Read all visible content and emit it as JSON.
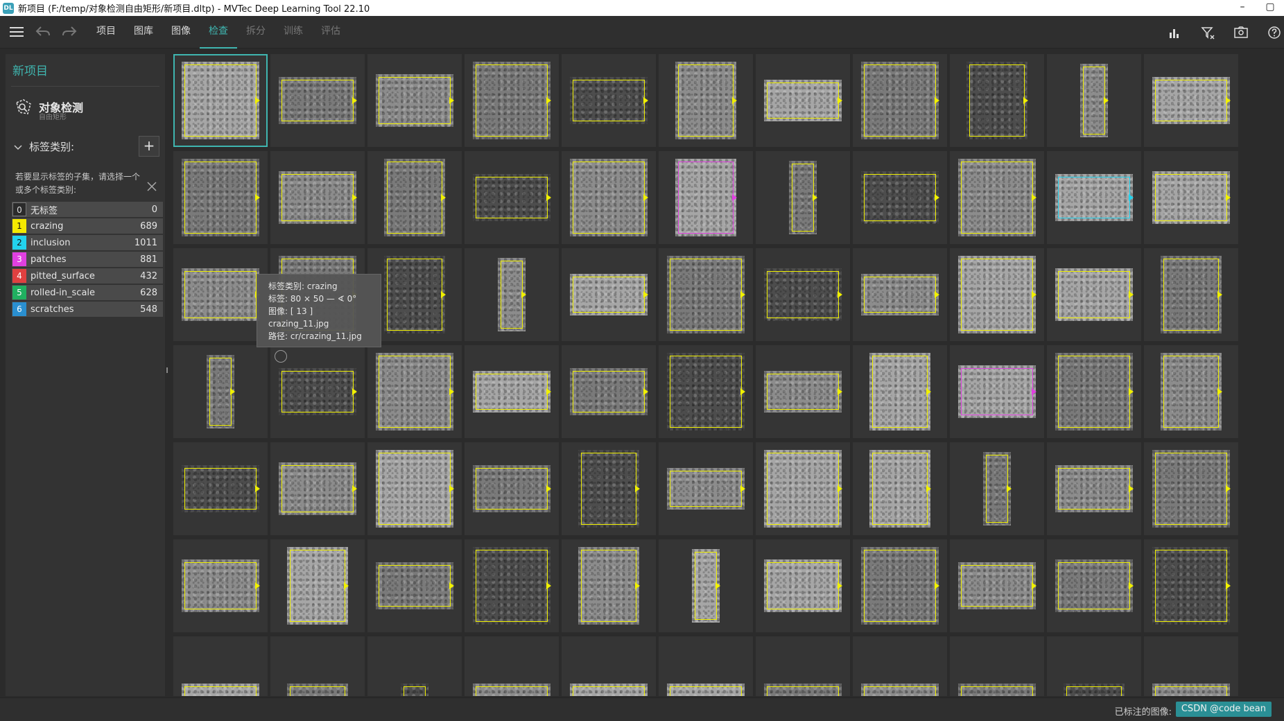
{
  "window": {
    "title": "新项目 (F:/temp/对象检测自由矩形/新项目.dltp) - MVTec Deep Learning Tool 22.10",
    "minimize": "–",
    "maximize": "▢"
  },
  "toolbar": {
    "menu": [
      "项目",
      "图库",
      "图像",
      "检查",
      "拆分",
      "训练",
      "评估"
    ],
    "active_menu": "检查",
    "disabled_menu": [
      "拆分",
      "训练",
      "评估"
    ]
  },
  "sidebar": {
    "project_title": "新项目",
    "task_name": "对象检测",
    "task_sub": "自由矩形",
    "section_title": "标签类别:",
    "add_label": "+",
    "hint": "若要显示标签的子集，请选择一个或多个标签类别:",
    "classes": [
      {
        "idx": "0",
        "name": "无标签",
        "count": "0",
        "color": "#2b2b2b"
      },
      {
        "idx": "1",
        "name": "crazing",
        "count": "689",
        "color": "#f5ea00"
      },
      {
        "idx": "2",
        "name": "inclusion",
        "count": "1011",
        "color": "#22d3ee"
      },
      {
        "idx": "3",
        "name": "patches",
        "count": "881",
        "color": "#e040e0"
      },
      {
        "idx": "4",
        "name": "pitted_surface",
        "count": "432",
        "color": "#e04040"
      },
      {
        "idx": "5",
        "name": "rolled-in_scale",
        "count": "628",
        "color": "#20b060"
      },
      {
        "idx": "6",
        "name": "scratches",
        "count": "548",
        "color": "#2a8fd0"
      }
    ]
  },
  "tooltip": {
    "line1": "标签类别: crazing",
    "line2": "标签: 80 × 50 — ∢ 0°",
    "line3": "图像: [ 13 ] crazing_11.jpg",
    "line4": "路径: cr/crazing_11.jpg"
  },
  "statusbar": {
    "label": "已标注的图像:",
    "badge": "CSDN @code bean"
  }
}
